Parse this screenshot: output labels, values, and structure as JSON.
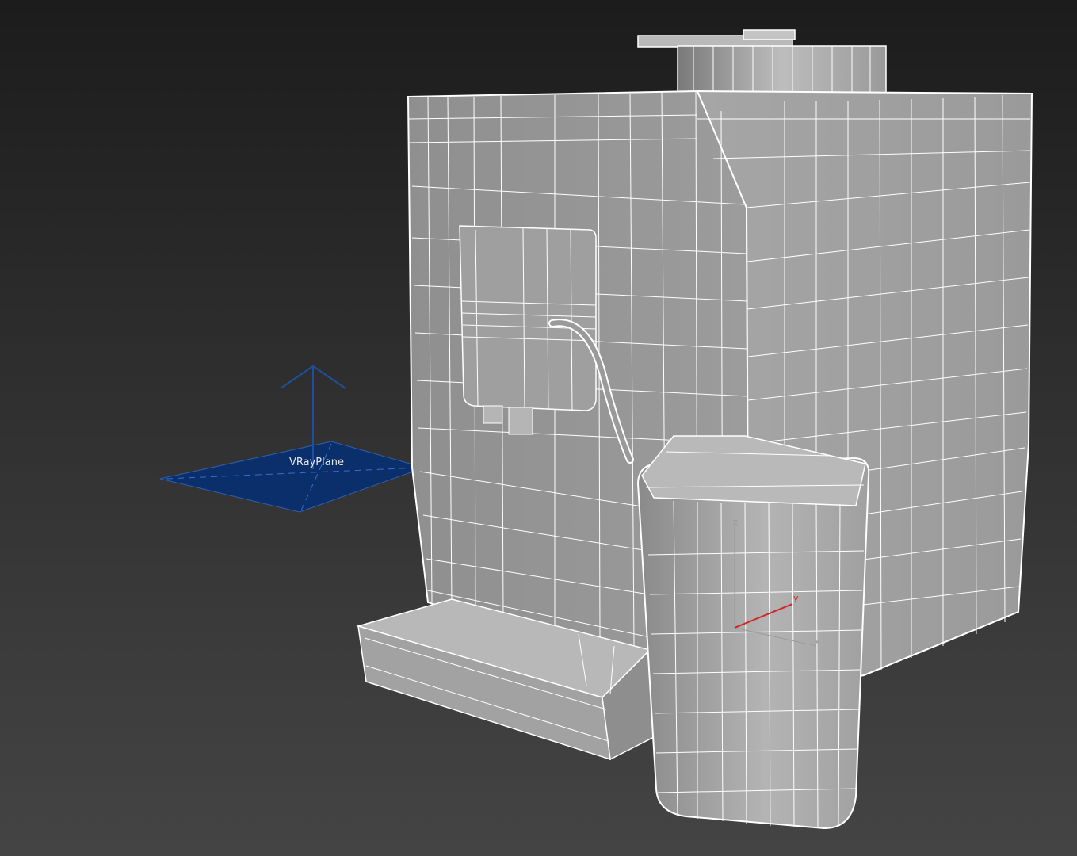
{
  "viewport": {
    "render_mode": "wireframe-over-shaded",
    "background_top": "#1c1c1c",
    "background_bottom": "#444444"
  },
  "objects": {
    "vray_plane": {
      "label": "VRayPlane",
      "color": "#0b2f6b",
      "edge_color": "#2f5fb0"
    },
    "coffee_machine": {
      "color": "#8d8d8d",
      "wire_color": "#ffffff"
    }
  },
  "gizmo": {
    "x_label": "x",
    "y_label": "y",
    "z_label": "z",
    "x_color": "#9a9a9a",
    "y_color": "#d42222",
    "z_color": "#9a9a9a"
  }
}
